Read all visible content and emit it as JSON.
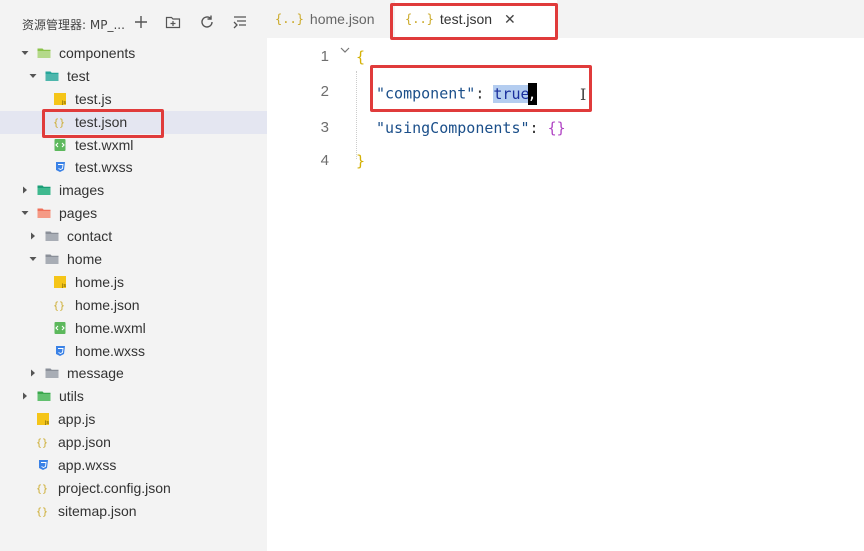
{
  "explorer": {
    "title": "资源管理器: MP_...",
    "actions": [
      {
        "name": "new-file",
        "icon": "plus-icon"
      },
      {
        "name": "new-folder",
        "icon": "new-folder-icon"
      },
      {
        "name": "refresh",
        "icon": "refresh-icon"
      },
      {
        "name": "collapse",
        "icon": "collapse-all-icon"
      }
    ],
    "tree": [
      {
        "label": "components",
        "depth": 0,
        "kind": "folder",
        "icon": "folder-components-icon",
        "expanded": true
      },
      {
        "label": "test",
        "depth": 1,
        "kind": "folder",
        "icon": "folder-teal-icon",
        "expanded": true
      },
      {
        "label": "test.js",
        "depth": 2,
        "kind": "js"
      },
      {
        "label": "test.json",
        "depth": 2,
        "kind": "json",
        "selected": true
      },
      {
        "label": "test.wxml",
        "depth": 2,
        "kind": "wxml"
      },
      {
        "label": "test.wxss",
        "depth": 2,
        "kind": "wxss"
      },
      {
        "label": "images",
        "depth": 0,
        "kind": "folder",
        "icon": "folder-images-icon",
        "expanded": false
      },
      {
        "label": "pages",
        "depth": 0,
        "kind": "folder",
        "icon": "folder-pages-icon",
        "expanded": true
      },
      {
        "label": "contact",
        "depth": 1,
        "kind": "folder",
        "icon": "folder-grey-icon",
        "expanded": false
      },
      {
        "label": "home",
        "depth": 1,
        "kind": "folder",
        "icon": "folder-grey-open-icon",
        "expanded": true
      },
      {
        "label": "home.js",
        "depth": 2,
        "kind": "js"
      },
      {
        "label": "home.json",
        "depth": 2,
        "kind": "json"
      },
      {
        "label": "home.wxml",
        "depth": 2,
        "kind": "wxml"
      },
      {
        "label": "home.wxss",
        "depth": 2,
        "kind": "wxss"
      },
      {
        "label": "message",
        "depth": 1,
        "kind": "folder",
        "icon": "folder-grey-icon",
        "expanded": false
      },
      {
        "label": "utils",
        "depth": 0,
        "kind": "folder",
        "icon": "folder-utils-icon",
        "expanded": false
      },
      {
        "label": "app.js",
        "depth": 0,
        "kind": "js"
      },
      {
        "label": "app.json",
        "depth": 0,
        "kind": "json"
      },
      {
        "label": "app.wxss",
        "depth": 0,
        "kind": "wxss"
      },
      {
        "label": "project.config.json",
        "depth": 0,
        "kind": "json"
      },
      {
        "label": "sitemap.json",
        "depth": 0,
        "kind": "json"
      }
    ]
  },
  "tabs": [
    {
      "label": "home.json",
      "icon_glyph": "{..}",
      "active": false
    },
    {
      "label": "test.json",
      "icon_glyph": "{..}",
      "active": true,
      "close_glyph": "✕"
    }
  ],
  "editor": {
    "line_numbers": [
      "1",
      "2",
      "3",
      "4"
    ],
    "lines": {
      "l1_open": "{",
      "l2_key": "\"component\"",
      "l2_colon": ": ",
      "l2_value": "true",
      "l2_comma": ",",
      "l3_key": "\"usingComponents\"",
      "l3_colon": ": ",
      "l3_value": "{}",
      "l4_close": "}"
    },
    "mouse_cursor_glyph": "I"
  },
  "colors": {
    "highlight_red": "#e03b3b",
    "json_brace": "#d4b106",
    "json_key": "#1b4f8a",
    "keyword": "#1a2f9c",
    "selection": "#b4cdf0",
    "sidebar_bg": "#f3f3f3",
    "selected_row_bg": "#e4e6f1"
  }
}
